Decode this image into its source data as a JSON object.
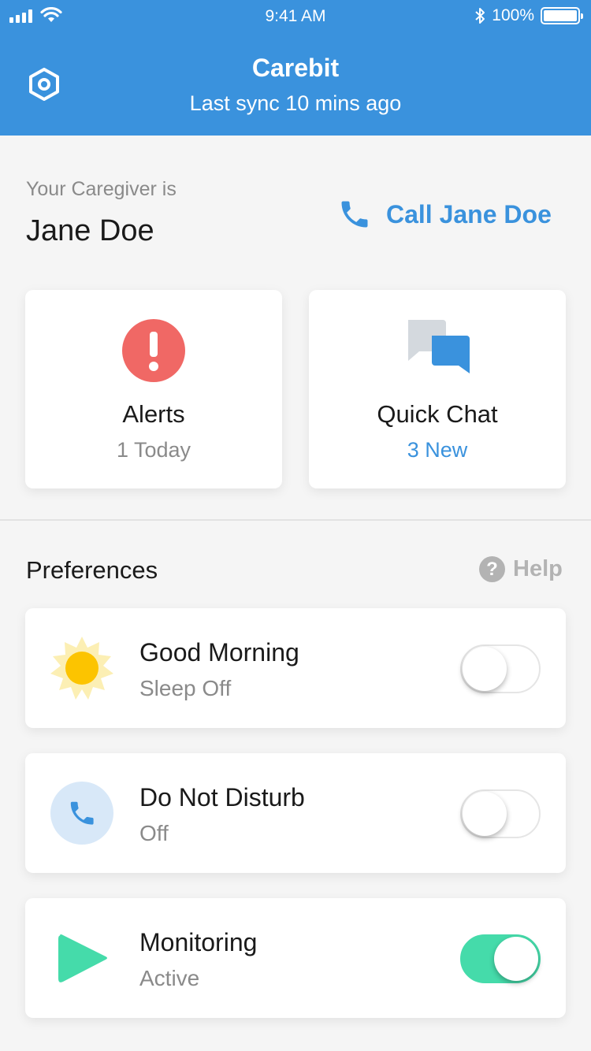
{
  "status_bar": {
    "time": "9:41 AM",
    "battery": "100%"
  },
  "header": {
    "title": "Carebit",
    "subtitle": "Last sync 10 mins ago",
    "settings_icon": "hexagon-settings-icon"
  },
  "caregiver": {
    "label": "Your Caregiver is",
    "name": "Jane Doe",
    "call_label": "Call Jane Doe"
  },
  "tiles": [
    {
      "title": "Alerts",
      "subtitle": "1 Today",
      "icon": "alert-icon",
      "icon_color": "#f06865"
    },
    {
      "title": "Quick Chat",
      "subtitle": "3 New",
      "icon": "chat-bubbles-icon",
      "icon_color": "#3a92dd"
    }
  ],
  "preferences": {
    "heading": "Preferences",
    "help_label": "Help",
    "items": [
      {
        "title": "Good Morning",
        "subtitle": "Sleep Off",
        "icon": "sun-icon",
        "enabled": false
      },
      {
        "title": "Do Not Disturb",
        "subtitle": "Off",
        "icon": "phone-icon",
        "enabled": false
      },
      {
        "title": "Monitoring",
        "subtitle": "Active",
        "icon": "play-icon",
        "enabled": true
      }
    ]
  },
  "colors": {
    "primary": "#3a92dd",
    "alert": "#f06865",
    "toggle_on": "#45dbaa",
    "sun": "#fcc400"
  }
}
